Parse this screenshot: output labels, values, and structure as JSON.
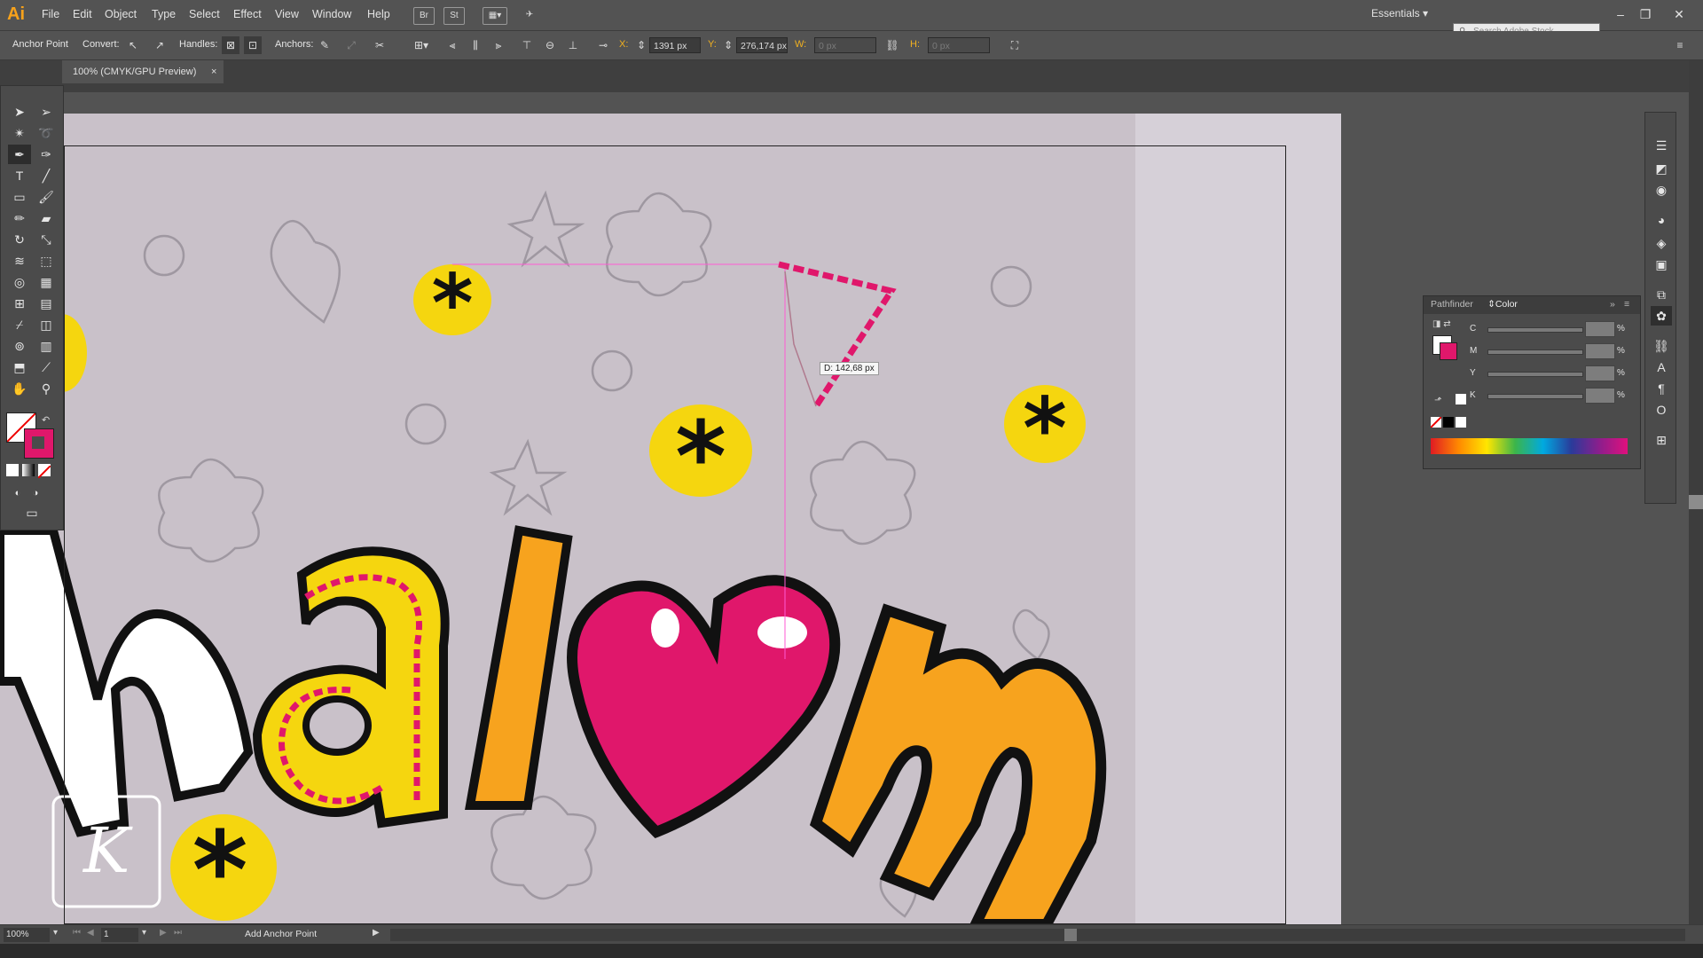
{
  "app": {
    "logo": "Ai"
  },
  "menu": [
    "File",
    "Edit",
    "Object",
    "Type",
    "Select",
    "Effect",
    "View",
    "Window",
    "Help"
  ],
  "menubar_icons": [
    "Br",
    "St"
  ],
  "workspace": "Essentials",
  "stock_search_placeholder": "Search Adobe Stock",
  "control_bar": {
    "tool_name": "Anchor Point",
    "convert_label": "Convert:",
    "handles_label": "Handles:",
    "anchors_label": "Anchors:",
    "x_label": "X:",
    "x_value": "1391 px",
    "y_label": "Y:",
    "y_value": "276,174 px",
    "w_label": "W:",
    "w_value": "0 px",
    "h_label": "H:",
    "h_value": "0 px"
  },
  "document_tab": {
    "title": "100% (CMYK/GPU Preview)",
    "close": "×"
  },
  "measure_tooltip": "D: 142,68 px",
  "artwork_text": "halom",
  "watermark_letter": "K",
  "color_panel": {
    "tabs": [
      "Pathfinder",
      "Color"
    ],
    "channels": [
      "C",
      "M",
      "Y",
      "K"
    ],
    "percent": "%"
  },
  "status": {
    "zoom": "100%",
    "page": "1",
    "text": "Add Anchor Point"
  },
  "colors": {
    "accent_pink": "#e0176b",
    "yellow": "#f5d60f",
    "orange": "#f7a31e"
  }
}
